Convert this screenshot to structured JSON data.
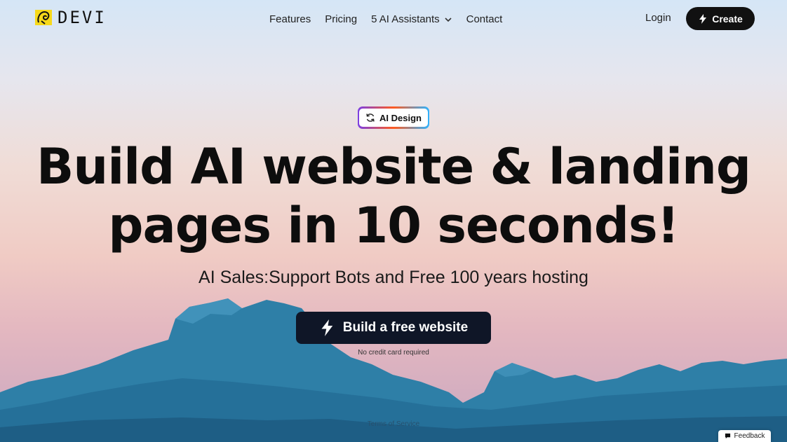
{
  "header": {
    "logo_text": "DEVI",
    "nav": [
      {
        "label": "Features"
      },
      {
        "label": "Pricing"
      },
      {
        "label": "5 AI Assistants"
      },
      {
        "label": "Contact"
      }
    ],
    "login_label": "Login",
    "create_label": "Create"
  },
  "hero": {
    "badge_label": "AI Design",
    "headline_line1": "Build AI website & landing",
    "headline_line2": "pages in 10 seconds!",
    "subline": "AI Sales:Support Bots and Free 100 years hosting",
    "cta_label": "Build a free website",
    "cta_note": "No credit card required"
  },
  "footer": {
    "terms_label": "Terms of Service",
    "feedback_label": "Feedback"
  },
  "icons": {
    "logo": "devi-logo-icon",
    "chevron": "chevron-down-icon",
    "bolt": "lightning-bolt-icon",
    "refresh": "refresh-icon",
    "chat": "chat-bubble-icon"
  },
  "colors": {
    "logo_yellow": "#f7d91a",
    "button_dark": "#111111",
    "cta_dark": "#0f1627",
    "badge_gradient": [
      "#7b3fe4",
      "#ff5a1f",
      "#2fb3ff"
    ]
  }
}
